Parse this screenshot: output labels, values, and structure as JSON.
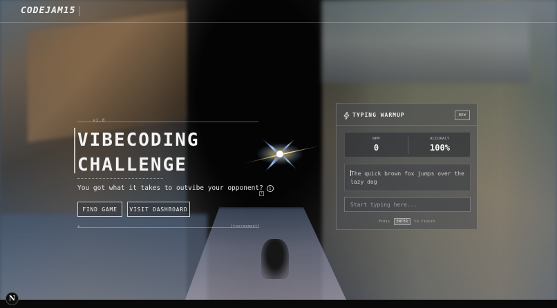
{
  "header": {
    "logo": "CODEJAM15"
  },
  "hero": {
    "version_label": "v1.0",
    "title_line1": "VIBECODING",
    "title_line2": "CHALLENGE",
    "tagline": "You got what it takes to outvibe your opponent?",
    "info_icon": "i",
    "small_square_glyph": "+",
    "find_game_label": "FIND GAME",
    "visit_dashboard_label": "VISIT DASHBOARD",
    "bottom_plus": "+",
    "bottom_label": "[tournament]"
  },
  "typing_panel": {
    "title": "TYPING WARMUP",
    "new_label": "NEW",
    "wpm_label": "WPM",
    "wpm_value": "0",
    "accuracy_label": "ACCURACY",
    "accuracy_value": "100%",
    "prompt_text": "The quick brown fox jumps over the lazy dog",
    "input_placeholder": "Start typing here...",
    "hint_before": "Press",
    "hint_key": "ENTER",
    "hint_after": "to finish"
  },
  "badge": {
    "label": "N"
  },
  "icons": {
    "bolt": "bolt-icon",
    "info": "info-icon",
    "star": "sparkle-star-icon"
  },
  "colors": {
    "text": "#f4f4f4",
    "panel_bg": "#46484e",
    "star_blue": "#6aa8ff",
    "star_gold": "#ffd27a"
  }
}
